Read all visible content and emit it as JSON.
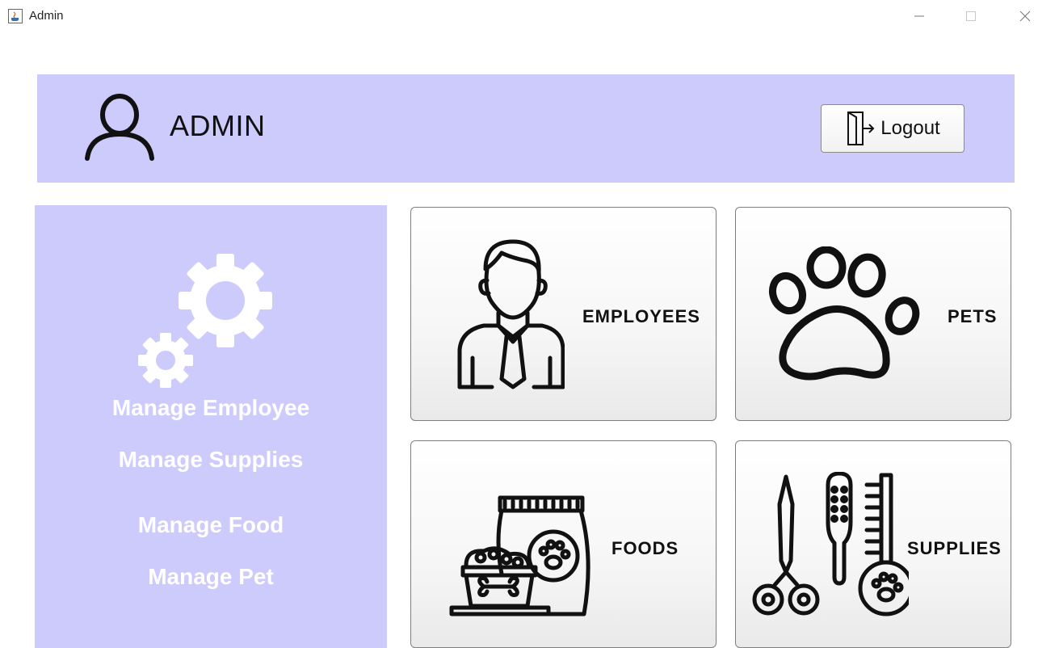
{
  "window": {
    "title": "Admin",
    "app_icon": "java-icon"
  },
  "header": {
    "user_icon": "user-icon",
    "username": "ADMIN",
    "logout_label": "Logout",
    "logout_icon": "logout-door-icon"
  },
  "sidebar": {
    "icon": "gears-icon",
    "items": [
      {
        "label": "Manage Employee"
      },
      {
        "label": "Manage Supplies"
      },
      {
        "label": "Manage Food"
      },
      {
        "label": "Manage Pet"
      }
    ]
  },
  "cards": [
    {
      "label": "EMPLOYEES",
      "icon": "employee-icon"
    },
    {
      "label": "PETS",
      "icon": "paw-icon"
    },
    {
      "label": "FOODS",
      "icon": "pet-food-icon"
    },
    {
      "label": "SUPPLIES",
      "icon": "grooming-supplies-icon"
    }
  ],
  "colors": {
    "panel": "#cccbfc",
    "text_dark": "#111111",
    "sidebar_text": "#ffffff"
  }
}
